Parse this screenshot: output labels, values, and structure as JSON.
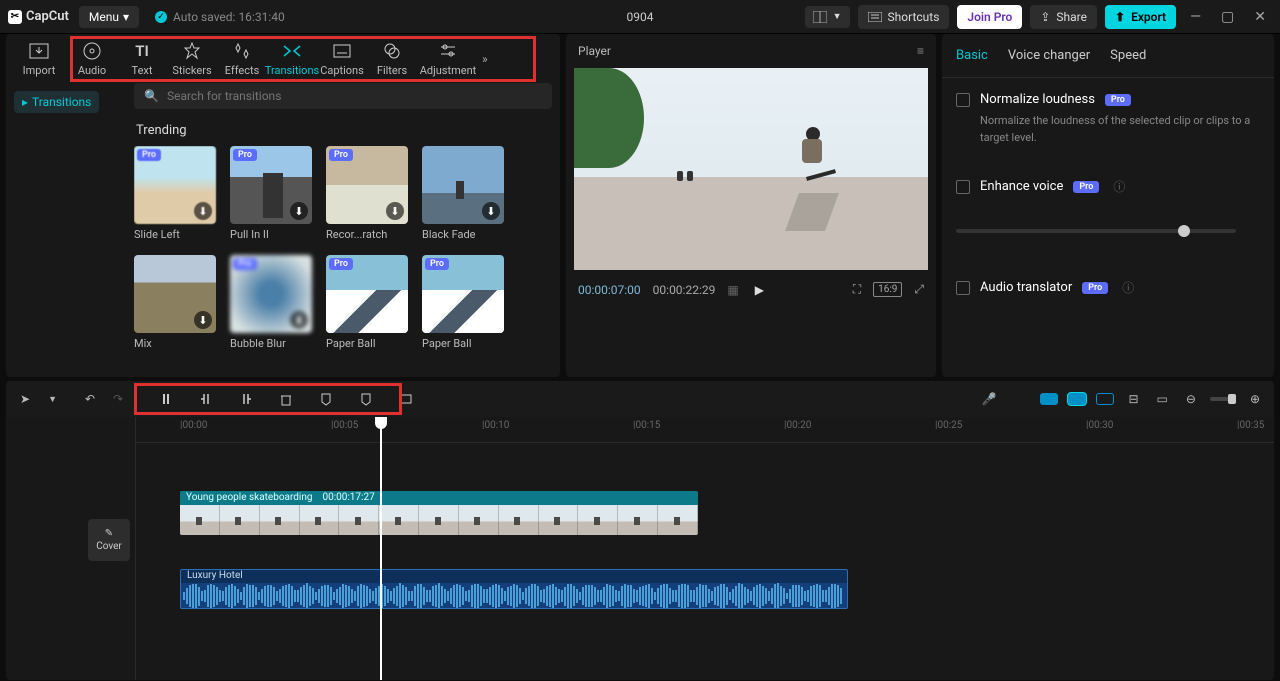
{
  "titlebar": {
    "app": "CapCut",
    "menu": "Menu",
    "autosave": "Auto saved: 16:31:40",
    "project": "0904",
    "shortcuts": "Shortcuts",
    "join": "Join Pro",
    "share": "Share",
    "export": "Export"
  },
  "tabs": {
    "import": "Import",
    "audio": "Audio",
    "text": "Text",
    "stickers": "Stickers",
    "effects": "Effects",
    "transitions": "Transitions",
    "captions": "Captions",
    "filters": "Filters",
    "adjustment": "Adjustment"
  },
  "side": {
    "transitions": "Transitions"
  },
  "search": {
    "placeholder": "Search for transitions"
  },
  "section": {
    "trending": "Trending"
  },
  "cards": {
    "c0": "Slide Left",
    "c1": "Pull In II",
    "c2": "Recor...ratch",
    "c3": "Black Fade",
    "c4": "Mix",
    "c5": "Bubble Blur",
    "c6": "Paper Ball",
    "c7": "Paper Ball",
    "pro": "Pro"
  },
  "player": {
    "label": "Player",
    "cur": "00:00:07:00",
    "tot": "00:00:22:29",
    "ratio": "16:9"
  },
  "right": {
    "basic": "Basic",
    "voice": "Voice changer",
    "speed": "Speed",
    "norm": "Normalize loudness",
    "norm_desc": "Normalize the loudness of the selected clip or clips to a target level.",
    "enhance": "Enhance voice",
    "translator": "Audio translator",
    "pro": "Pro"
  },
  "cover": "Cover",
  "clip": {
    "video_name": "Young people skateboarding",
    "video_dur": "00:00:17:27",
    "audio_name": "Luxury Hotel"
  },
  "ruler": {
    "t0": "00:00",
    "t5": "00:05",
    "t10": "00:10",
    "t15": "00:15",
    "t20": "00:20",
    "t25": "00:25",
    "t30": "00:30",
    "t35": "00:35"
  }
}
